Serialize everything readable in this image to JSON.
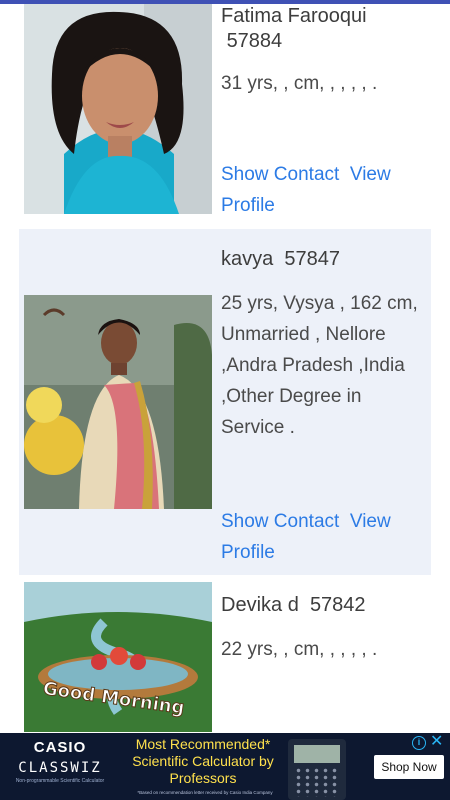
{
  "profiles": [
    {
      "name": "Fatima Farooqui",
      "id": "57884",
      "details": "31 yrs, ,   cm,  ,  , , , .",
      "show_contact": "Show Contact",
      "view_profile": "View Profile"
    },
    {
      "name": "kavya",
      "id": "57847",
      "details": "25 yrs, Vysya ,  162 cm, Unmarried , Nellore ,Andra Pradesh ,India ,Other Degree in Service .",
      "show_contact": "Show Contact",
      "view_profile": "View Profile"
    },
    {
      "name": "Devika d",
      "id": "57842",
      "details": "22 yrs, ,   cm,  ,  , , , .",
      "photo_text": "Good Morning"
    }
  ],
  "ad": {
    "brand": "CASIO",
    "product": "CLASSWIZ",
    "tagline": "Non-programmable Scientific Calculator",
    "headline": "Most Recommended* Scientific Calculator by Professors",
    "fine_print": "*Based on recommendation letter received by Casio India Company",
    "cta": "Shop Now"
  },
  "colors": {
    "link": "#2c7be5",
    "alt_card_bg": "#edf1f9",
    "ad_bg": "#0d1830",
    "ad_headline": "#ffe14d"
  }
}
